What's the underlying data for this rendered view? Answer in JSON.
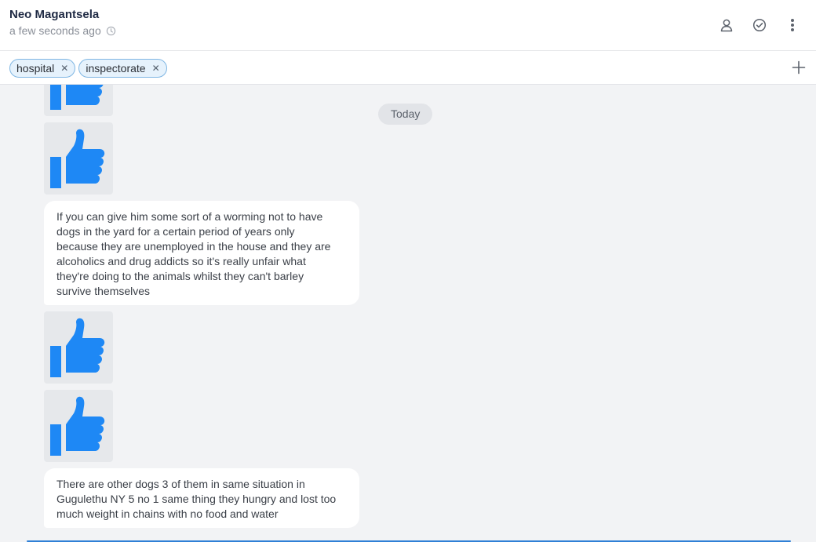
{
  "header": {
    "contact_name": "Neo Magantsela",
    "last_seen": "a few seconds ago",
    "icons": [
      "person-icon",
      "check-circle-icon",
      "more-vertical-icon"
    ]
  },
  "tags": [
    {
      "label": "hospital"
    },
    {
      "label": "inspectorate"
    }
  ],
  "conversation": {
    "day_separator": "Today",
    "messages": [
      {
        "type": "sticker",
        "icon": "thumbs-up-icon"
      },
      {
        "type": "sticker",
        "icon": "thumbs-up-icon"
      },
      {
        "type": "text",
        "text": "If you can give him some sort of a worming not to have\ndogs in the yard for a certain period of years only\nbecause they are unemployed in the house and they are\nalcoholics and drug addicts so it's really unfair what\nthey're doing to the animals whilst they can't barley\nsurvive themselves"
      },
      {
        "type": "sticker",
        "icon": "thumbs-up-icon"
      },
      {
        "type": "sticker",
        "icon": "thumbs-up-icon"
      },
      {
        "type": "text",
        "text": "There are other dogs 3 of them in same situation in\nGugulethu NY 5 no 1 same thing they hungry and lost too\nmuch weight in chains with no food and water"
      }
    ]
  },
  "colors": {
    "accent": "#1e88f5",
    "tag_border": "#7fb6e3",
    "background": "#f2f3f5"
  }
}
